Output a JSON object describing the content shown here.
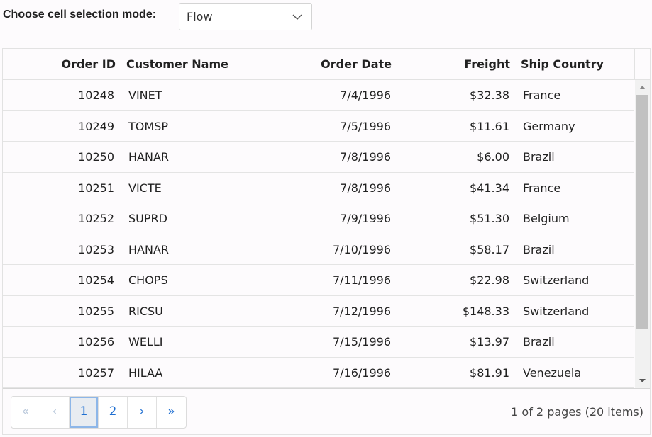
{
  "selection_mode": {
    "label": "Choose cell selection mode:",
    "value": "Flow"
  },
  "grid": {
    "columns": [
      "Order ID",
      "Customer Name",
      "Order Date",
      "Freight",
      "Ship Country"
    ],
    "rows": [
      {
        "order_id": "10248",
        "customer": "VINET",
        "date": "7/4/1996",
        "freight": "$32.38",
        "country": "France"
      },
      {
        "order_id": "10249",
        "customer": "TOMSP",
        "date": "7/5/1996",
        "freight": "$11.61",
        "country": "Germany"
      },
      {
        "order_id": "10250",
        "customer": "HANAR",
        "date": "7/8/1996",
        "freight": "$6.00",
        "country": "Brazil"
      },
      {
        "order_id": "10251",
        "customer": "VICTE",
        "date": "7/8/1996",
        "freight": "$41.34",
        "country": "France"
      },
      {
        "order_id": "10252",
        "customer": "SUPRD",
        "date": "7/9/1996",
        "freight": "$51.30",
        "country": "Belgium"
      },
      {
        "order_id": "10253",
        "customer": "HANAR",
        "date": "7/10/1996",
        "freight": "$58.17",
        "country": "Brazil"
      },
      {
        "order_id": "10254",
        "customer": "CHOPS",
        "date": "7/11/1996",
        "freight": "$22.98",
        "country": "Switzerland"
      },
      {
        "order_id": "10255",
        "customer": "RICSU",
        "date": "7/12/1996",
        "freight": "$148.33",
        "country": "Switzerland"
      },
      {
        "order_id": "10256",
        "customer": "WELLI",
        "date": "7/15/1996",
        "freight": "$13.97",
        "country": "Brazil"
      },
      {
        "order_id": "10257",
        "customer": "HILAA",
        "date": "7/16/1996",
        "freight": "$81.91",
        "country": "Venezuela"
      }
    ]
  },
  "pager": {
    "first": "«",
    "prev": "‹",
    "pages": [
      "1",
      "2"
    ],
    "next": "›",
    "last": "»",
    "info": "1 of 2 pages (20 items)"
  },
  "colors": {
    "accent": "#1f6fd1",
    "active_page_border": "#8db6e8",
    "scroll_thumb": "#c1c1c1"
  },
  "icons": {
    "dropdown": "chevron-down-icon",
    "scroll_up": "triangle-up-icon",
    "scroll_down": "triangle-down-icon"
  }
}
